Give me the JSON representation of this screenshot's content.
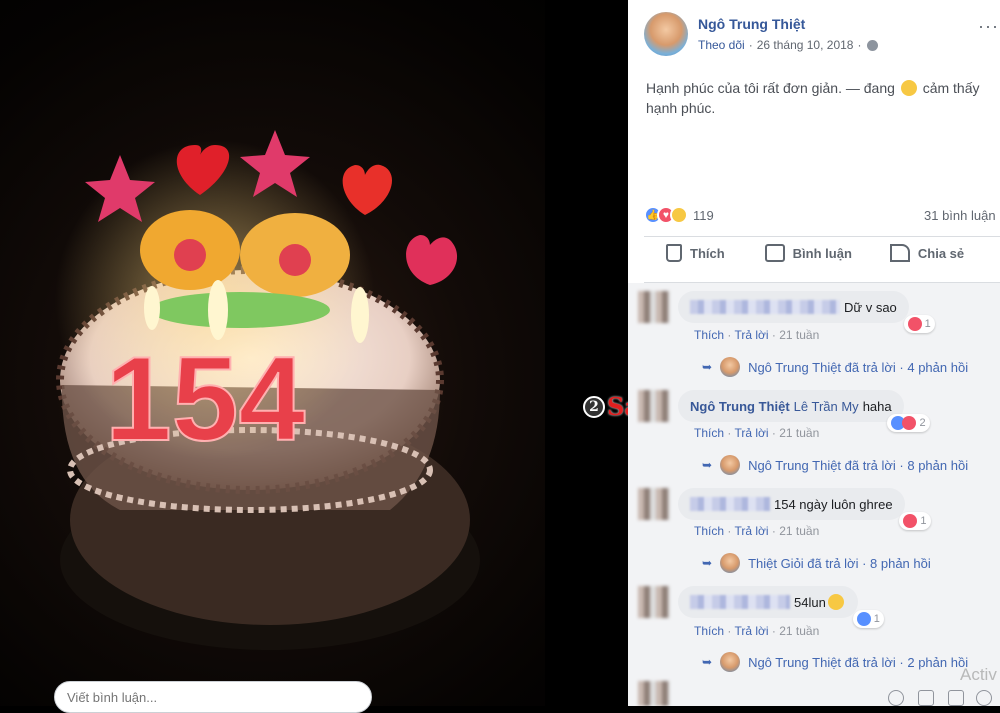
{
  "post": {
    "author": "Ngô Trung Thiệt",
    "follow": "Theo dõi",
    "date": "26 tháng 10, 2018",
    "separator": "·",
    "more": "···",
    "text_before": "Hạnh phúc của tôi rất đơn giản. — đang",
    "text_after": "cảm thấy hạnh phúc.",
    "reaction_count": "119",
    "comment_count": "31 bình luận"
  },
  "actions": {
    "like": "Thích",
    "comment": "Bình luận",
    "share": "Chia sẻ"
  },
  "photo": {
    "watermark_number": "2",
    "watermark_text": "Sao"
  },
  "comments": [
    {
      "name": "",
      "text": "Dữ v sao",
      "react_count": "1",
      "like": "Thích",
      "reply": "Trả lời",
      "time": "21 tuần",
      "reply_summary": "Ngô Trung Thiệt đã trả lời · 4 phản hồi"
    },
    {
      "name": "Ngô Trung Thiệt",
      "mention": "Lê Trần My",
      "text": "haha",
      "react_count": "2",
      "like": "Thích",
      "reply": "Trả lời",
      "time": "21 tuần",
      "reply_summary": "Ngô Trung Thiệt đã trả lời · 8 phản hồi"
    },
    {
      "name": "",
      "text": "154 ngày luôn ghree",
      "react_count": "1",
      "like": "Thích",
      "reply": "Trả lời",
      "time": "21 tuần",
      "reply_summary": "Thiệt Giỏi đã trả lời · 8 phản hồi"
    },
    {
      "name": "",
      "text": "54lun",
      "react_count": "1",
      "like": "Thích",
      "reply": "Trả lời",
      "time": "21 tuần",
      "reply_summary": "Ngô Trung Thiệt đã trả lời · 2 phản hồi"
    }
  ],
  "composer": {
    "placeholder": "Viết bình luận..."
  },
  "overlay": {
    "activate": "Activ"
  },
  "colors": {
    "link": "#365899",
    "like_blue": "#5890ff",
    "love_red": "#f25268",
    "haha_yellow": "#f7c843"
  }
}
